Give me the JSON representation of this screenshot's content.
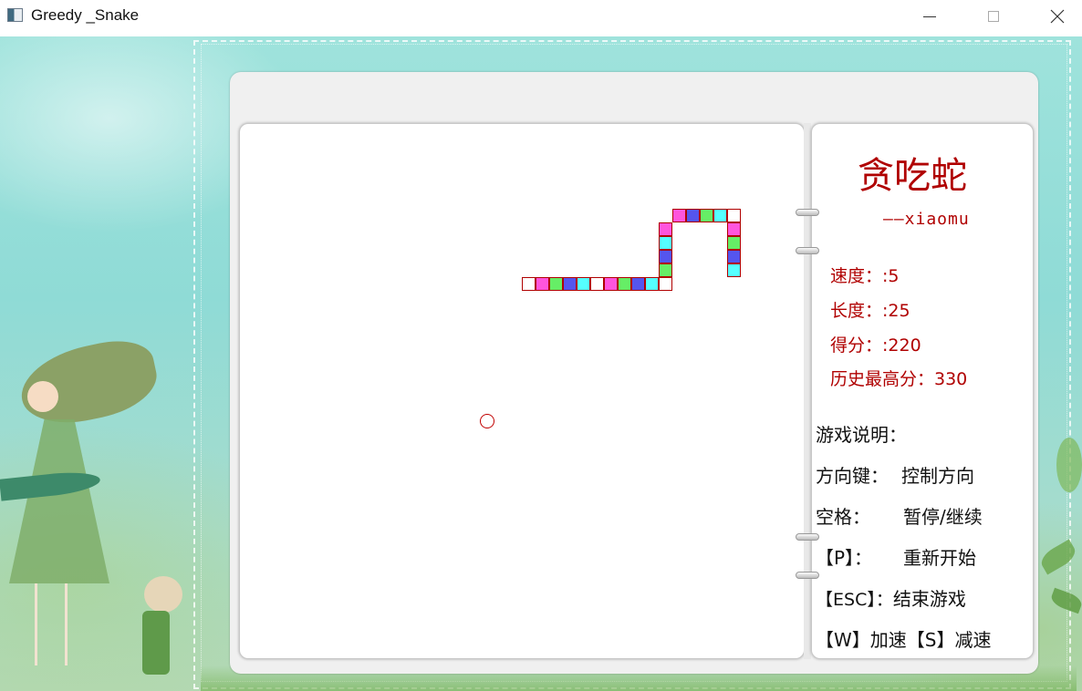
{
  "window": {
    "title": "Greedy _Snake"
  },
  "colors": {
    "accent_red": "#b00000",
    "snake_colors": [
      "#ffffff",
      "#ff55dd",
      "#66ee66",
      "#5555ee",
      "#55ffff"
    ]
  },
  "info": {
    "title": "贪吃蛇",
    "author": "——xiaomu",
    "speed": "速度：:5",
    "length": "长度：:25",
    "score": "得分：:220",
    "best": "历史最高分：330"
  },
  "help": {
    "heading": "游戏说明：",
    "rows": [
      {
        "key": "方向键：",
        "action": "控制方向"
      },
      {
        "key": "空格：",
        "action": "暂停/继续"
      },
      {
        "key": "【P】：",
        "action": "重新开始"
      },
      {
        "key": "【ESC】：",
        "action": "结束游戏"
      },
      {
        "key": "【W】加速",
        "action": "【S】减速"
      }
    ]
  },
  "game": {
    "snake_length": 25,
    "food_present": true
  }
}
